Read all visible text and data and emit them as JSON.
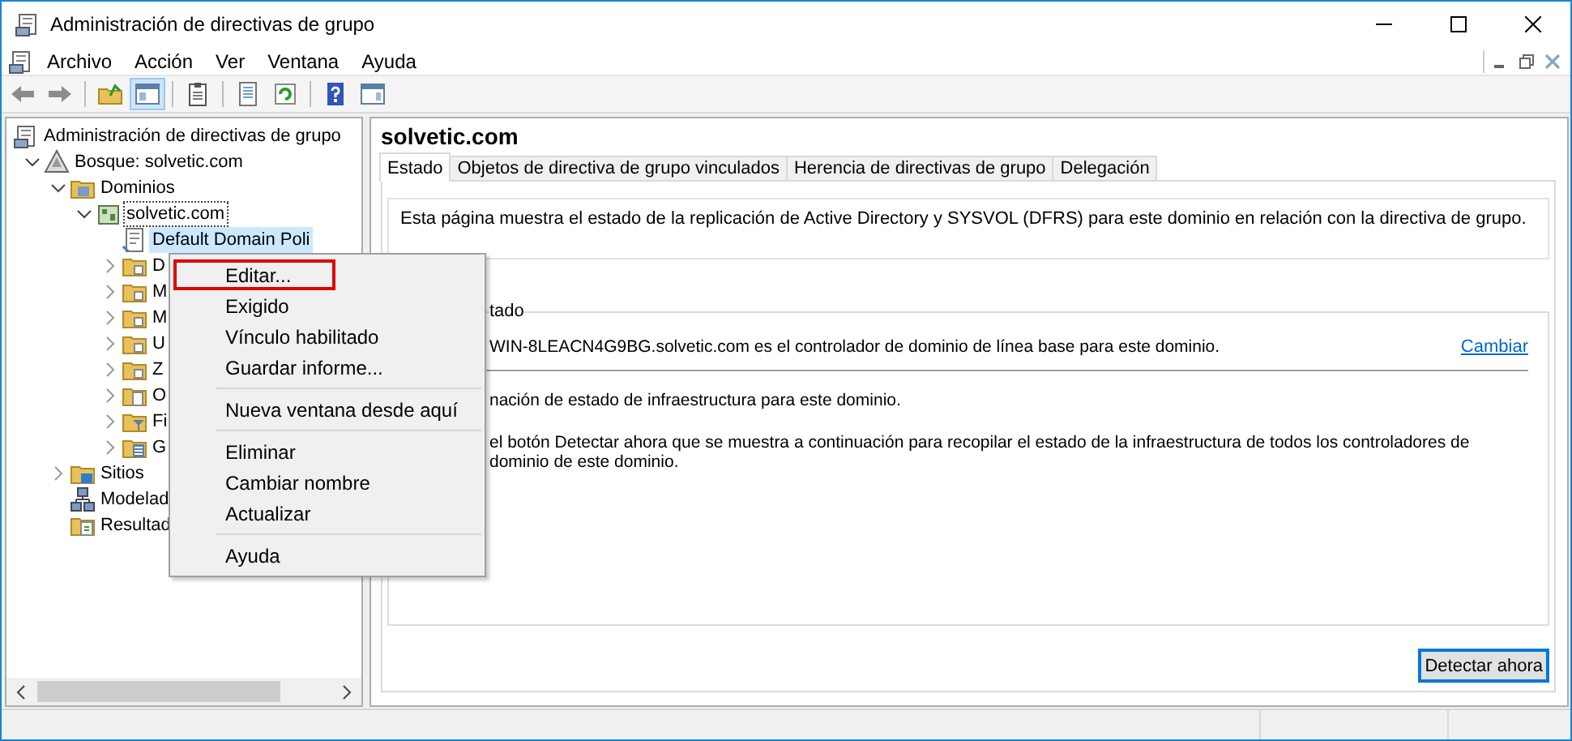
{
  "window": {
    "title": "Administración de directivas de grupo"
  },
  "menu_bar": [
    "Archivo",
    "Acción",
    "Ver",
    "Ventana",
    "Ayuda"
  ],
  "toolbar": [
    {
      "pressed": false
    },
    {
      "pressed": false
    },
    {
      "pressed": false
    },
    {
      "pressed": true
    },
    {
      "pressed": false
    },
    {
      "pressed": false
    },
    {
      "pressed": false
    },
    {
      "pressed": false
    },
    {
      "pressed": false
    }
  ],
  "tree": [
    {
      "label": "Administración de directivas de grupo",
      "kind": "console",
      "selected": false,
      "focused": false,
      "children": [
        {
          "label": "Bosque: solvetic.com",
          "kind": "forest",
          "expanded": true,
          "selected": false,
          "focused": false,
          "children": [
            {
              "label": "Dominios",
              "kind": "domains",
              "expanded": true,
              "selected": false,
              "focused": false,
              "children": [
                {
                  "label": "solvetic.com",
                  "kind": "domain",
                  "expanded": true,
                  "selected": false,
                  "focused": true,
                  "children": [
                    {
                      "label": "Default Domain Poli",
                      "kind": "gpo-link",
                      "selected": true,
                      "focused": false
                    },
                    {
                      "label": "D",
                      "kind": "ou",
                      "expanded": false,
                      "selected": false,
                      "focused": false
                    },
                    {
                      "label": "M",
                      "kind": "ou",
                      "expanded": false,
                      "selected": false,
                      "focused": false
                    },
                    {
                      "label": "M",
                      "kind": "ou",
                      "expanded": false,
                      "selected": false,
                      "focused": false
                    },
                    {
                      "label": "U",
                      "kind": "ou",
                      "expanded": false,
                      "selected": false,
                      "focused": false
                    },
                    {
                      "label": "Z",
                      "kind": "ou",
                      "expanded": false,
                      "selected": false,
                      "focused": false
                    },
                    {
                      "label": "O",
                      "kind": "gpo-folder",
                      "expanded": false,
                      "selected": false,
                      "focused": false
                    },
                    {
                      "label": "Fi",
                      "kind": "filter",
                      "expanded": false,
                      "selected": false,
                      "focused": false
                    },
                    {
                      "label": "G",
                      "kind": "starter",
                      "expanded": false,
                      "selected": false,
                      "focused": false
                    }
                  ]
                }
              ]
            },
            {
              "label": "Sitios",
              "kind": "sites",
              "expanded": false,
              "selected": false,
              "focused": false
            },
            {
              "label": "Modelad",
              "kind": "modeling",
              "selected": false,
              "focused": false
            },
            {
              "label": "Resultad",
              "kind": "results",
              "selected": false,
              "focused": false
            }
          ]
        }
      ]
    }
  ],
  "details": {
    "title": "solvetic.com",
    "tabs": [
      {
        "label": "Estado",
        "selected": true
      },
      {
        "label": "Objetos de directiva de grupo vinculados",
        "selected": false
      },
      {
        "label": "Herencia de directivas de grupo",
        "selected": false
      },
      {
        "label": "Delegación",
        "selected": false
      }
    ],
    "description": "Esta página muestra el estado de la replicación de Active Directory y SYSVOL (DFRS) para este dominio en relación con la directiva de grupo.",
    "group": {
      "legend": "tado",
      "baseline": "WIN-8LEACN4G9BG.solvetic.com es el controlador de dominio de línea base para este dominio.",
      "link": "Cambiar",
      "info": "nación de estado de infraestructura para este dominio.",
      "instruction": "el botón Detectar ahora que se muestra a continuación para recopilar el estado de la infraestructura de todos los controladores de dominio de este dominio."
    },
    "button": {
      "label": "Detectar ahora",
      "focused": true
    }
  },
  "context_menu": {
    "groups": [
      [
        {
          "label": "Editar...",
          "annotated": true
        },
        {
          "label": "Exigido",
          "annotated": false
        },
        {
          "label": "Vínculo habilitado",
          "annotated": false
        },
        {
          "label": "Guardar informe...",
          "annotated": false
        }
      ],
      [
        {
          "label": "Nueva ventana desde aquí",
          "annotated": false
        }
      ],
      [
        {
          "label": "Eliminar",
          "annotated": false
        },
        {
          "label": "Cambiar nombre",
          "annotated": false
        },
        {
          "label": "Actualizar",
          "annotated": false
        }
      ],
      [
        {
          "label": "Ayuda",
          "annotated": false
        }
      ]
    ]
  }
}
